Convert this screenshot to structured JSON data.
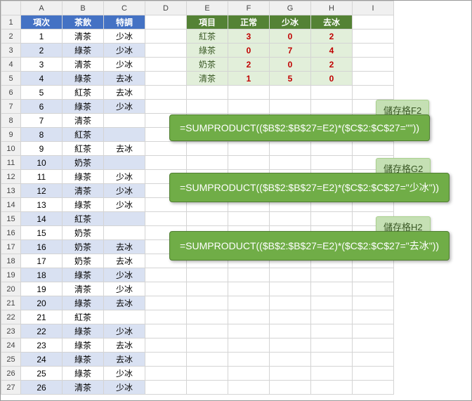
{
  "cols": [
    "A",
    "B",
    "C",
    "D",
    "E",
    "F",
    "G",
    "H",
    "I"
  ],
  "rows": [
    "1",
    "2",
    "3",
    "4",
    "5",
    "6",
    "7",
    "8",
    "9",
    "10",
    "11",
    "12",
    "13",
    "14",
    "15",
    "16",
    "17",
    "18",
    "19",
    "20",
    "21",
    "22",
    "23",
    "24",
    "25",
    "26",
    "27"
  ],
  "left_header": {
    "a": "項次",
    "b": "茶飲",
    "c": "特調"
  },
  "left_data": [
    {
      "n": "1",
      "d": "清茶",
      "s": "少冰"
    },
    {
      "n": "2",
      "d": "綠茶",
      "s": "少冰"
    },
    {
      "n": "3",
      "d": "清茶",
      "s": "少冰"
    },
    {
      "n": "4",
      "d": "綠茶",
      "s": "去冰"
    },
    {
      "n": "5",
      "d": "紅茶",
      "s": "去冰"
    },
    {
      "n": "6",
      "d": "綠茶",
      "s": "少冰"
    },
    {
      "n": "7",
      "d": "清茶",
      "s": ""
    },
    {
      "n": "8",
      "d": "紅茶",
      "s": ""
    },
    {
      "n": "9",
      "d": "紅茶",
      "s": "去冰"
    },
    {
      "n": "10",
      "d": "奶茶",
      "s": ""
    },
    {
      "n": "11",
      "d": "綠茶",
      "s": "少冰"
    },
    {
      "n": "12",
      "d": "清茶",
      "s": "少冰"
    },
    {
      "n": "13",
      "d": "綠茶",
      "s": "少冰"
    },
    {
      "n": "14",
      "d": "紅茶",
      "s": ""
    },
    {
      "n": "15",
      "d": "奶茶",
      "s": ""
    },
    {
      "n": "16",
      "d": "奶茶",
      "s": "去冰"
    },
    {
      "n": "17",
      "d": "奶茶",
      "s": "去冰"
    },
    {
      "n": "18",
      "d": "綠茶",
      "s": "少冰"
    },
    {
      "n": "19",
      "d": "清茶",
      "s": "少冰"
    },
    {
      "n": "20",
      "d": "綠茶",
      "s": "去冰"
    },
    {
      "n": "21",
      "d": "紅茶",
      "s": ""
    },
    {
      "n": "22",
      "d": "綠茶",
      "s": "少冰"
    },
    {
      "n": "23",
      "d": "綠茶",
      "s": "去冰"
    },
    {
      "n": "24",
      "d": "綠茶",
      "s": "去冰"
    },
    {
      "n": "25",
      "d": "綠茶",
      "s": "少冰"
    },
    {
      "n": "26",
      "d": "清茶",
      "s": "少冰"
    }
  ],
  "right_header": {
    "e": "項目",
    "f": "正常",
    "g": "少冰",
    "h": "去冰"
  },
  "right_data": [
    {
      "e": "紅茶",
      "f": "3",
      "g": "0",
      "h": "2"
    },
    {
      "e": "綠茶",
      "f": "0",
      "g": "7",
      "h": "4"
    },
    {
      "e": "奶茶",
      "f": "2",
      "g": "0",
      "h": "2"
    },
    {
      "e": "清茶",
      "f": "1",
      "g": "5",
      "h": "0"
    }
  ],
  "tags": {
    "f2": "儲存格F2",
    "g2": "儲存格G2",
    "h2": "儲存格H2"
  },
  "formulas": {
    "f2": "=SUMPRODUCT(($B$2:$B$27=E2)*($C$2:$C$27=\"\"))",
    "g2": "=SUMPRODUCT(($B$2:$B$27=E2)*($C$2:$C$27=\"少冰\"))",
    "h2": "=SUMPRODUCT(($B$2:$B$27=E2)*($C$2:$C$27=\"去冰\"))"
  }
}
